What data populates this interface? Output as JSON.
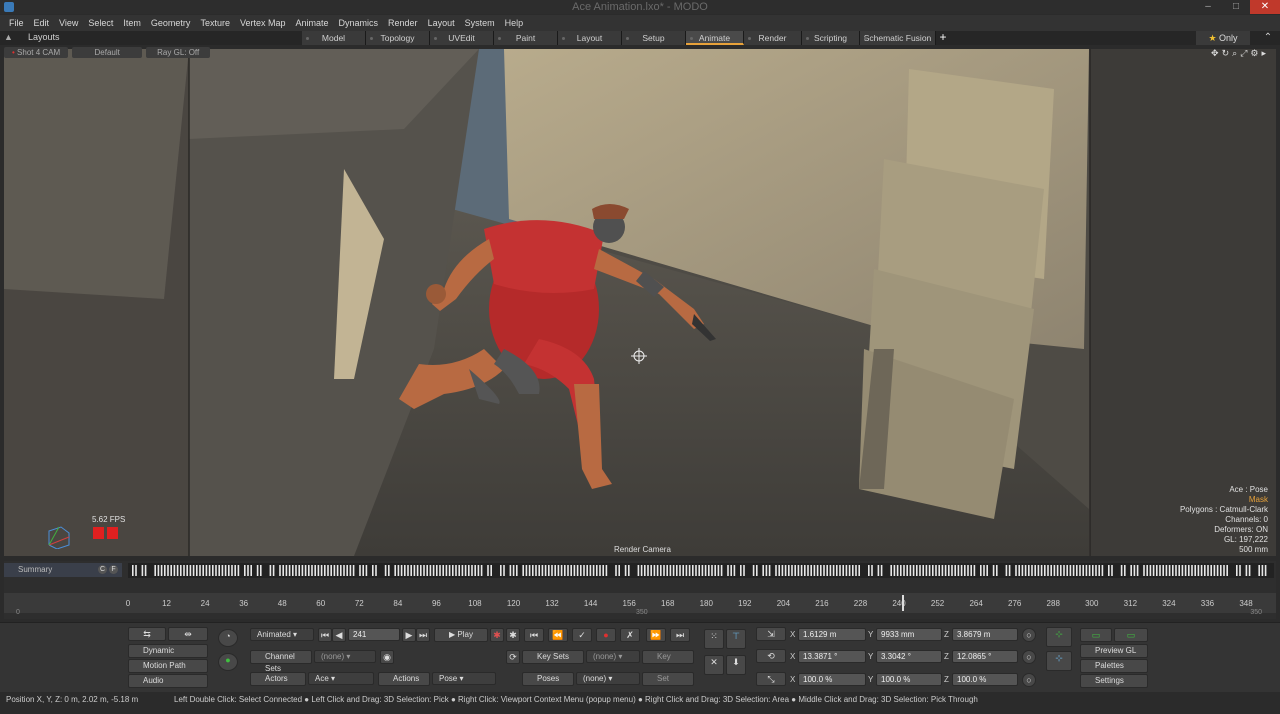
{
  "window": {
    "title": "Ace Animation.lxo* - MODO"
  },
  "menu": [
    "File",
    "Edit",
    "View",
    "Select",
    "Item",
    "Geometry",
    "Texture",
    "Vertex Map",
    "Animate",
    "Dynamics",
    "Render",
    "Layout",
    "System",
    "Help"
  ],
  "layoutbar": {
    "label": "Layouts",
    "tabs": [
      "Model",
      "Topology",
      "UVEdit",
      "Paint",
      "Layout",
      "Setup",
      "Animate",
      "Render",
      "Scripting",
      "Schematic Fusion"
    ],
    "active_tab": "Animate",
    "only_label": "Only"
  },
  "viewport": {
    "camera_btn": "Shot 4 CAM",
    "style_btn": "Default",
    "raygl_btn": "Ray GL: Off",
    "fps": "5.62 FPS",
    "render_camera": "Render Camera",
    "info": {
      "line1": "Ace : Pose",
      "line2": "Mask",
      "line3": "Polygons : Catmull-Clark",
      "line4": "Channels: 0",
      "line5": "Deformers: ON",
      "line6": "GL: 197,222",
      "line7": "500 mm"
    }
  },
  "timeline": {
    "summary_label": "Summary",
    "c_label": "C",
    "f_label": "F",
    "ticks": [
      "0",
      "12",
      "24",
      "36",
      "48",
      "60",
      "72",
      "84",
      "96",
      "108",
      "120",
      "132",
      "144",
      "156",
      "168",
      "180",
      "192",
      "204",
      "216",
      "228",
      "240",
      "252",
      "264",
      "276",
      "288",
      "300",
      "312",
      "324",
      "336",
      "348"
    ],
    "current_frame_tick": "241",
    "range_start": "0",
    "range_mid": "350",
    "range_end": "350"
  },
  "controls": {
    "dynamic_parenting": "Dynamic Parenting",
    "motion_path": "Motion Path",
    "audio": "Audio",
    "mode_dropdown": "Animated",
    "frame": "241",
    "play": "Play",
    "channel_sets": "Channel Sets",
    "none1": "(none)",
    "key_sets": "Key Sets",
    "none2": "(none)",
    "key": "Key",
    "actors": "Actors",
    "actor_value": "Ace",
    "actions": "Actions",
    "action_value": "Pose",
    "poses": "Poses",
    "none3": "(none)",
    "set": "Set",
    "pos_x": "1.6129 m",
    "pos_y": "9933 mm",
    "pos_z": "3.8679 m",
    "rot_x": "13.3871 °",
    "rot_y": "3.3042 °",
    "rot_z": "12.0865 °",
    "scl_x": "100.0 %",
    "scl_y": "100.0 %",
    "scl_z": "100.0 %",
    "x": "X",
    "y": "Y",
    "z": "Z",
    "preview_gl": "Preview GL",
    "palettes": "Palettes",
    "settings": "Settings"
  },
  "status": {
    "position": "Position X, Y, Z:   0 m, 2.02 m, -5.18 m",
    "hint": "Left Double Click: Select Connected ● Left Click and Drag: 3D Selection: Pick ● Right Click: Viewport Context Menu (popup menu) ● Right Click and Drag: 3D Selection: Area ● Middle Click and Drag: 3D Selection: Pick Through"
  },
  "colors": {
    "accent": "#e8a23a",
    "record": "#e03030"
  }
}
